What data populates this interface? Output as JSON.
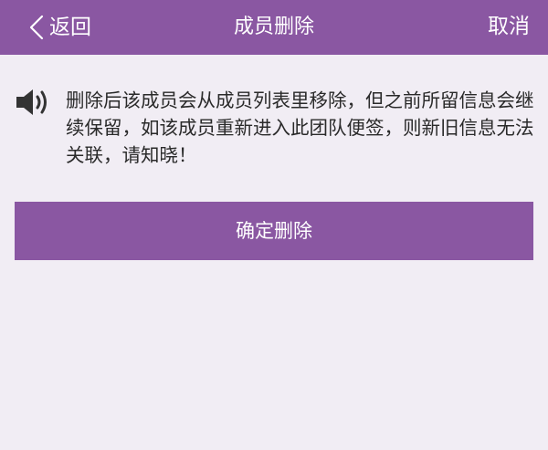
{
  "header": {
    "back_label": "返回",
    "title": "成员删除",
    "cancel_label": "取消"
  },
  "notice": {
    "icon": "speaker-icon",
    "text": "删除后该成员会从成员列表里移除，但之前所留信息会继续保留，如该成员重新进入此团队便签，则新旧信息无法关联，请知晓！"
  },
  "actions": {
    "confirm_label": "确定删除"
  },
  "colors": {
    "accent": "#8a57a2",
    "background": "#f1edf4",
    "text": "#2a2a2a"
  }
}
